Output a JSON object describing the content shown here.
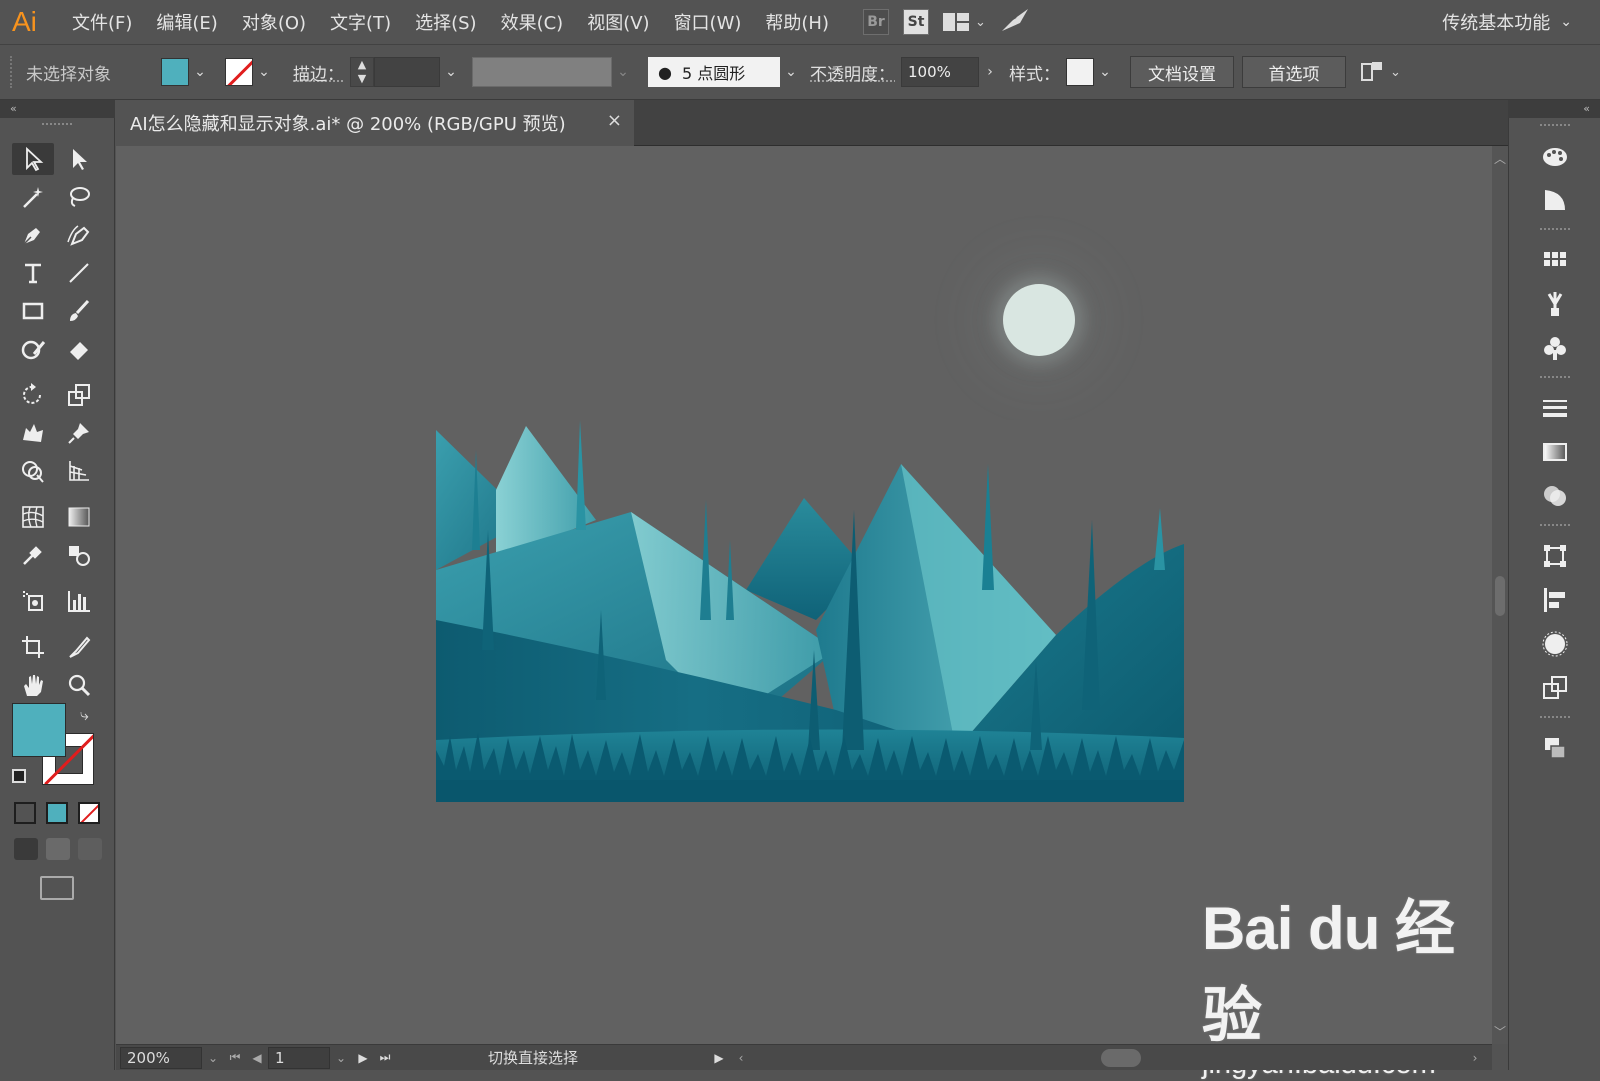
{
  "app": {
    "logo": "Ai"
  },
  "menu": [
    "文件(F)",
    "编辑(E)",
    "对象(O)",
    "文字(T)",
    "选择(S)",
    "效果(C)",
    "视图(V)",
    "窗口(W)",
    "帮助(H)"
  ],
  "menu_icons": {
    "bridge": "Br",
    "stock": "St"
  },
  "workspace": {
    "label": "传统基本功能"
  },
  "control_bar": {
    "selection_status": "未选择对象",
    "fill_color": "#4fb0bd",
    "stroke_label": "描边：",
    "brush_label": "5 点圆形",
    "opacity_label": "不透明度：",
    "opacity_value": "100%",
    "style_label": "样式：",
    "doc_setup_button": "文档设置",
    "preferences_button": "首选项"
  },
  "document": {
    "tab_title": "AI怎么隐藏和显示对象.ai* @ 200% (RGB/GPU 预览)",
    "close_symbol": "×"
  },
  "status_bar": {
    "zoom": "200%",
    "artboard_number": "1",
    "status_text": "切换直接选择"
  },
  "watermark": {
    "brand": "Bai du 经验",
    "url": "jingyan.baidu.com"
  },
  "colors": {
    "accent": "#4fb0bd",
    "dark_teal": "#0d5c72",
    "moon": "#d9e6e1"
  }
}
